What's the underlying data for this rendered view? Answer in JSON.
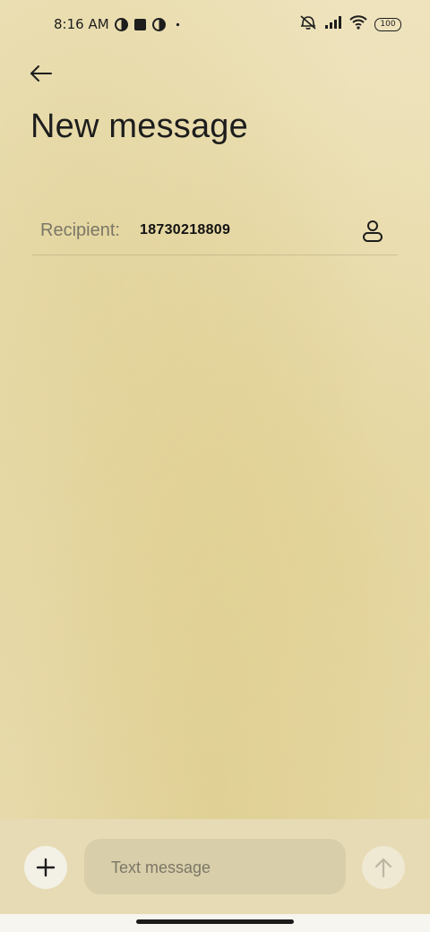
{
  "status_bar": {
    "time": "8:16 AM",
    "battery": "100",
    "left_icons": [
      "circle-half-icon",
      "square-icon",
      "circle-half-icon",
      "dot-icon"
    ],
    "right_icons": [
      "mute-icon",
      "signal-icon",
      "wifi-icon",
      "battery-icon"
    ]
  },
  "header": {
    "title": "New message"
  },
  "recipient": {
    "label": "Recipient:",
    "value": "18730218809"
  },
  "composer": {
    "placeholder": "Text message"
  },
  "colors": {
    "background": "#ece1b9",
    "composer_bg": "#e6dbb4",
    "input_bg": "#d9ceaa",
    "text_primary": "#1d1d1d",
    "text_secondary": "#7a7767"
  }
}
